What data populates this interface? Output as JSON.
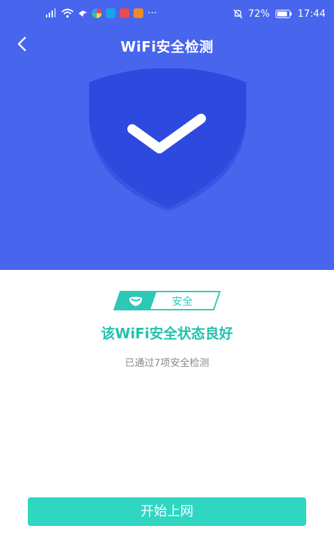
{
  "status_bar": {
    "dots": "···",
    "battery": "72%",
    "time": "17:44"
  },
  "titlebar": {
    "title": "WiFi安全检测"
  },
  "result": {
    "tag_label": "安全",
    "headline": "该WiFi安全状态良好",
    "subtext": "已通过7项安全检测"
  },
  "actions": {
    "start_label": "开始上网"
  },
  "colors": {
    "header_bg": "#4865ee",
    "shield": "#2f4be0",
    "accent": "#2fd6c2",
    "headline": "#22c2ad"
  }
}
